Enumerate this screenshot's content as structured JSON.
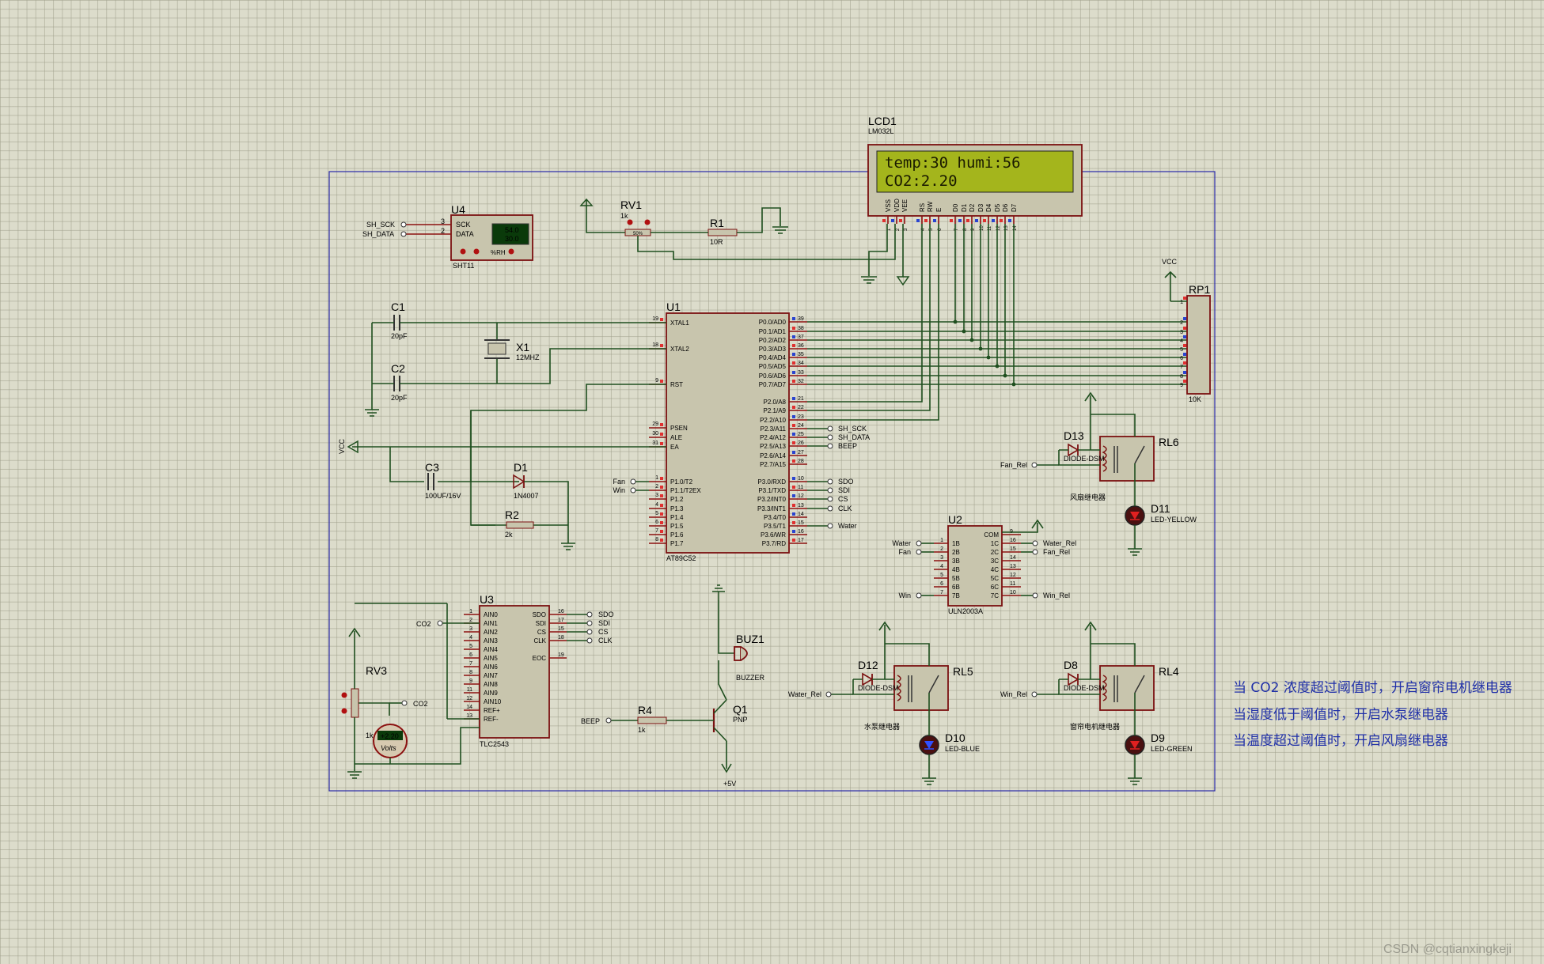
{
  "lcd": {
    "ref": "LCD1",
    "model": "LM032L",
    "line1": "temp:30 humi:56",
    "line2": "CO2:2.20",
    "pins": [
      "VSS",
      "VDD",
      "VEE",
      "RS",
      "RW",
      "E",
      "D0",
      "D1",
      "D2",
      "D3",
      "D4",
      "D5",
      "D6",
      "D7"
    ]
  },
  "u4": {
    "ref": "U4",
    "model": "SHT11",
    "pin_sck": "SCK",
    "pin_data": "DATA",
    "display1": "54.0",
    "display2": "30.0",
    "unit": "%RH",
    "net_sck": "SH_SCK",
    "net_data": "SH_DATA",
    "pin_no1": "3",
    "pin_no2": "2"
  },
  "rv1": {
    "ref": "RV1",
    "value": "1k",
    "pct": "50%"
  },
  "r1": {
    "ref": "R1",
    "value": "10R"
  },
  "u1": {
    "ref": "U1",
    "model": "AT89C52",
    "left_pins": [
      {
        "no": "19",
        "name": "XTAL1"
      },
      {
        "no": "18",
        "name": "XTAL2"
      },
      {
        "no": "9",
        "name": "RST"
      },
      {
        "no": "29",
        "name": "PSEN"
      },
      {
        "no": "30",
        "name": "ALE"
      },
      {
        "no": "31",
        "name": "EA"
      },
      {
        "no": "1",
        "name": "P1.0/T2"
      },
      {
        "no": "2",
        "name": "P1.1/T2EX"
      },
      {
        "no": "3",
        "name": "P1.2"
      },
      {
        "no": "4",
        "name": "P1.3"
      },
      {
        "no": "5",
        "name": "P1.4"
      },
      {
        "no": "6",
        "name": "P1.5"
      },
      {
        "no": "7",
        "name": "P1.6"
      },
      {
        "no": "8",
        "name": "P1.7"
      }
    ],
    "right_pins": [
      {
        "no": "39",
        "name": "P0.0/AD0"
      },
      {
        "no": "38",
        "name": "P0.1/AD1"
      },
      {
        "no": "37",
        "name": "P0.2/AD2"
      },
      {
        "no": "36",
        "name": "P0.3/AD3"
      },
      {
        "no": "35",
        "name": "P0.4/AD4"
      },
      {
        "no": "34",
        "name": "P0.5/AD5"
      },
      {
        "no": "33",
        "name": "P0.6/AD6"
      },
      {
        "no": "32",
        "name": "P0.7/AD7"
      },
      {
        "no": "21",
        "name": "P2.0/A8"
      },
      {
        "no": "22",
        "name": "P2.1/A9"
      },
      {
        "no": "23",
        "name": "P2.2/A10"
      },
      {
        "no": "24",
        "name": "P2.3/A11"
      },
      {
        "no": "25",
        "name": "P2.4/A12"
      },
      {
        "no": "26",
        "name": "P2.5/A13"
      },
      {
        "no": "27",
        "name": "P2.6/A14"
      },
      {
        "no": "28",
        "name": "P2.7/A15"
      },
      {
        "no": "10",
        "name": "P3.0/RXD"
      },
      {
        "no": "11",
        "name": "P3.1/TXD"
      },
      {
        "no": "12",
        "name": "P3.2/INT0"
      },
      {
        "no": "13",
        "name": "P3.3/INT1"
      },
      {
        "no": "14",
        "name": "P3.4/T0"
      },
      {
        "no": "15",
        "name": "P3.5/T1"
      },
      {
        "no": "16",
        "name": "P3.6/WR"
      },
      {
        "no": "17",
        "name": "P3.7/RD"
      }
    ],
    "net_p23": "SH_SCK",
    "net_p24": "SH_DATA",
    "net_p25": "BEEP",
    "net_p30": "SDO",
    "net_p31": "SDI",
    "net_p32": "CS",
    "net_p33": "CLK",
    "net_p35": "Water",
    "net_p10": "Fan",
    "net_p11": "Win"
  },
  "c1": {
    "ref": "C1",
    "value": "20pF"
  },
  "c2": {
    "ref": "C2",
    "value": "20pF"
  },
  "x1": {
    "ref": "X1",
    "value": "12MHZ"
  },
  "c3": {
    "ref": "C3",
    "value": "100UF/16V"
  },
  "d1": {
    "ref": "D1",
    "value": "1N4007"
  },
  "r2": {
    "ref": "R2",
    "value": "2k"
  },
  "vcc_left": "VCC",
  "rp1": {
    "ref": "RP1",
    "value": "10K",
    "vcc": "VCC",
    "pins": [
      "1",
      "2",
      "3",
      "4",
      "5",
      "6",
      "7",
      "8",
      "9"
    ]
  },
  "d13": {
    "ref": "D13",
    "value": "DIODE-DSM"
  },
  "rl6": {
    "ref": "RL6",
    "caption": "风扇继电器",
    "net": "Fan_Rel"
  },
  "d11": {
    "ref": "D11",
    "value": "LED-YELLOW"
  },
  "u2": {
    "ref": "U2",
    "model": "ULN2003A",
    "left": [
      {
        "no": "1",
        "name": "1B",
        "net": "Water"
      },
      {
        "no": "2",
        "name": "2B",
        "net": "Fan"
      },
      {
        "no": "3",
        "name": "3B",
        "net": ""
      },
      {
        "no": "4",
        "name": "4B",
        "net": ""
      },
      {
        "no": "5",
        "name": "5B",
        "net": ""
      },
      {
        "no": "6",
        "name": "6B",
        "net": ""
      },
      {
        "no": "7",
        "name": "7B",
        "net": "Win"
      }
    ],
    "right": [
      {
        "no": "9",
        "name": "COM",
        "net": ""
      },
      {
        "no": "16",
        "name": "1C",
        "net": "Water_Rel"
      },
      {
        "no": "15",
        "name": "2C",
        "net": "Fan_Rel"
      },
      {
        "no": "14",
        "name": "3C",
        "net": ""
      },
      {
        "no": "13",
        "name": "4C",
        "net": ""
      },
      {
        "no": "12",
        "name": "5C",
        "net": ""
      },
      {
        "no": "11",
        "name": "6C",
        "net": ""
      },
      {
        "no": "10",
        "name": "7C",
        "net": "Win_Rel"
      }
    ]
  },
  "u3": {
    "ref": "U3",
    "model": "TLC2543",
    "left": [
      {
        "no": "1",
        "name": "AIN0"
      },
      {
        "no": "2",
        "name": "AIN1"
      },
      {
        "no": "3",
        "name": "AIN2"
      },
      {
        "no": "4",
        "name": "AIN3"
      },
      {
        "no": "5",
        "name": "AIN4"
      },
      {
        "no": "6",
        "name": "AIN5"
      },
      {
        "no": "7",
        "name": "AIN6"
      },
      {
        "no": "8",
        "name": "AIN7"
      },
      {
        "no": "9",
        "name": "AIN8"
      },
      {
        "no": "11",
        "name": "AIN9"
      },
      {
        "no": "12",
        "name": "AIN10"
      },
      {
        "no": "14",
        "name": "REF+"
      },
      {
        "no": "13",
        "name": "REF-"
      }
    ],
    "right": [
      {
        "no": "16",
        "name": "SDO",
        "net": "SDO"
      },
      {
        "no": "17",
        "name": "SDI",
        "net": "SDI"
      },
      {
        "no": "15",
        "name": "CS",
        "net": "CS"
      },
      {
        "no": "18",
        "name": "CLK",
        "net": "CLK"
      },
      {
        "no": "19",
        "name": "EOC",
        "net": ""
      }
    ],
    "net_ain1": "CO2"
  },
  "rv3": {
    "ref": "RV3",
    "value": "1k",
    "net": "CO2",
    "meter": "+2.20",
    "meter_unit": "Volts"
  },
  "buz1": {
    "ref": "BUZ1",
    "value": "BUZZER"
  },
  "q1": {
    "ref": "Q1",
    "value": "PNP",
    "supply": "+5V"
  },
  "r4": {
    "ref": "R4",
    "value": "1k",
    "net": "BEEP"
  },
  "d12": {
    "ref": "D12",
    "value": "DIODE-DSM"
  },
  "rl5": {
    "ref": "RL5",
    "caption": "水泵继电器",
    "net": "Water_Rel"
  },
  "d10": {
    "ref": "D10",
    "value": "LED-BLUE"
  },
  "d8": {
    "ref": "D8",
    "value": "DIODE-DSM"
  },
  "rl4": {
    "ref": "RL4",
    "caption": "窗帘电机继电器",
    "net": "Win_Rel"
  },
  "d9": {
    "ref": "D9",
    "value": "LED-GREEN"
  },
  "notes": [
    "当 CO2 浓度超过阈值时，开启窗帘电机继电器",
    "当湿度低于阈值时，开启水泵继电器",
    "当温度超过阈值时，开启风扇继电器"
  ],
  "watermark": "CSDN @cqtianxingkeji"
}
